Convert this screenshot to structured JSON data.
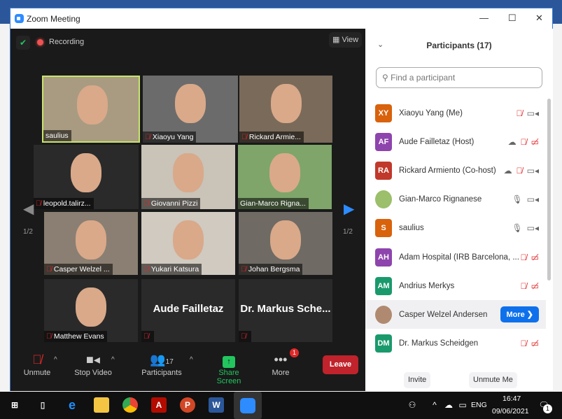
{
  "window": {
    "title": "Zoom Meeting",
    "minimize": "—",
    "maximize": "☐",
    "close": "✕"
  },
  "meeting": {
    "recording": "Recording",
    "view": "View",
    "page_left": "1/2",
    "page_right": "1/2",
    "tiles": [
      {
        "name": "saulius",
        "muted": false
      },
      {
        "name": "Xiaoyu Yang",
        "muted": true
      },
      {
        "name": "Rickard Armie...",
        "muted": true
      },
      {
        "name": "leopold.talirz...",
        "muted": true
      },
      {
        "name": "Giovanni Pizzi",
        "muted": true
      },
      {
        "name": "Gian-Marco Rigna...",
        "muted": false
      },
      {
        "name": "Casper Welzel ...",
        "muted": true
      },
      {
        "name": "Yukari Katsura",
        "muted": true
      },
      {
        "name": "Johan Bergsma",
        "muted": true
      },
      {
        "name": "Matthew Evans",
        "muted": true
      },
      {
        "name": "",
        "big": "Aude Failletaz",
        "muted": true
      },
      {
        "name": "",
        "big": "Dr. Markus Sche...",
        "muted": true
      }
    ]
  },
  "toolbar": {
    "unmute": "Unmute",
    "stop_video": "Stop Video",
    "participants": "Participants",
    "participants_count": "17",
    "share_screen": "Share Screen",
    "more": "More",
    "more_badge": "1",
    "leave": "Leave"
  },
  "panel": {
    "title": "Participants (17)",
    "search_placeholder": "Find a participant",
    "more_button": "More ❯",
    "invite": "Invite",
    "unmute_me": "Unmute Me",
    "participants": [
      {
        "initials": "XY",
        "name": "Xiaoyu Yang (Me)",
        "color": "#d9620c",
        "mic": "muted",
        "video": "on",
        "recording": false
      },
      {
        "initials": "AF",
        "name": "Aude Failletaz (Host)",
        "color": "#8e44ad",
        "mic": "muted",
        "video": "off",
        "recording": true
      },
      {
        "initials": "RA",
        "name": "Rickard Armiento (Co-host)",
        "color": "#c0392b",
        "mic": "muted",
        "video": "on",
        "recording": true
      },
      {
        "initials": "",
        "name": "Gian-Marco Rignanese",
        "color": "#9bbf6a",
        "mic": "on",
        "video": "on",
        "recording": false
      },
      {
        "initials": "S",
        "name": "saulius",
        "color": "#d9620c",
        "mic": "on",
        "video": "on",
        "recording": false
      },
      {
        "initials": "AH",
        "name": "Adam Hospital (IRB Barcelona, ...",
        "color": "#8e44ad",
        "mic": "muted",
        "video": "off",
        "recording": false
      },
      {
        "initials": "AM",
        "name": "Andrius Merkys",
        "color": "#1a9a6c",
        "mic": "muted",
        "video": "off",
        "recording": false
      },
      {
        "initials": "",
        "name": "Casper Welzel Andersen",
        "color": "#b08a70",
        "mic": "",
        "video": "",
        "recording": false
      },
      {
        "initials": "DM",
        "name": "Dr. Markus Scheidgen",
        "color": "#1a9a6c",
        "mic": "muted",
        "video": "off",
        "recording": false
      }
    ]
  },
  "taskbar": {
    "time": "16:47",
    "date": "09/06/2021",
    "lang": "ENG",
    "notif": "1"
  }
}
